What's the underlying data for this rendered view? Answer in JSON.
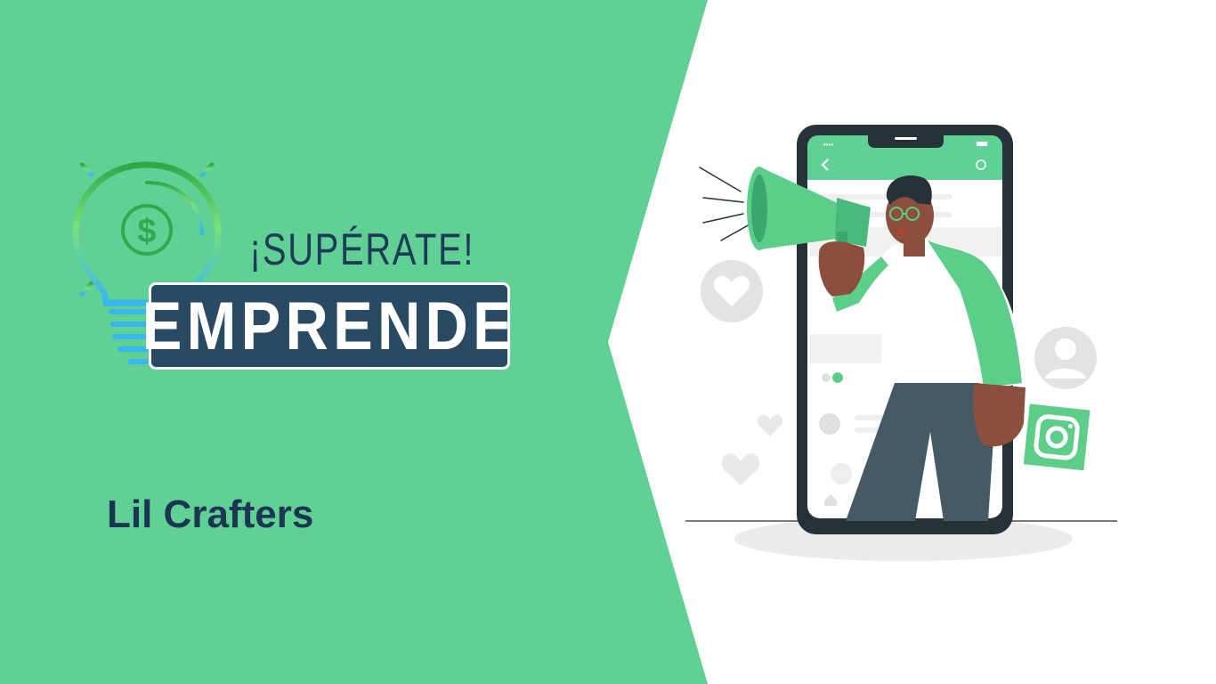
{
  "hero": {
    "tagline": "¡SUPÉRATE!",
    "brand": "EMPRENDE",
    "company_name": "Lil Crafters"
  },
  "colors": {
    "green_panel": "#61d094",
    "navy": "#284a62",
    "text_dark": "#1c3553",
    "accent_green": "#5dcd8a",
    "phone_frame": "#263238"
  },
  "icons": [
    "lightbulb-icon",
    "dollar-icon",
    "heart-icon",
    "user-icon",
    "instagram-icon",
    "megaphone-icon",
    "gear-icon",
    "back-arrow-icon",
    "home-icon"
  ]
}
